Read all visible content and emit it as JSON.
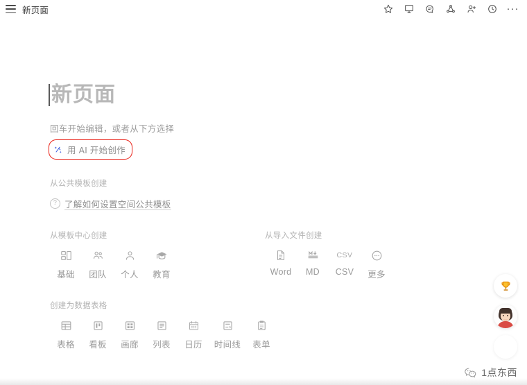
{
  "topbar": {
    "menu_icon": "hamburger-menu-icon",
    "doc_title": "新页面",
    "icons": [
      {
        "name": "star-icon",
        "label": "收藏"
      },
      {
        "name": "presentation-icon",
        "label": "演示"
      },
      {
        "name": "comment-icon",
        "label": "评论"
      },
      {
        "name": "share-network-icon",
        "label": "分享"
      },
      {
        "name": "add-person-icon",
        "label": "协作者"
      },
      {
        "name": "history-clock-icon",
        "label": "历史"
      },
      {
        "name": "more-dots-icon",
        "label": "更多"
      }
    ],
    "more_glyph": "···"
  },
  "document": {
    "title_placeholder": "新页面",
    "hint": "回车开始编辑，或者从下方选择",
    "ai_action": {
      "icon": "ai-sparkle-icon",
      "label": "用 AI 开始创作",
      "highlight_color": "#e8190f"
    }
  },
  "public_template_section": {
    "label": "从公共模板创建",
    "link": {
      "icon": "question-circle-icon",
      "label": "了解如何设置空间公共模板"
    }
  },
  "template_center_section": {
    "label": "从模板中心创建",
    "items": [
      {
        "icon": "layout-grid-icon",
        "label": "基础"
      },
      {
        "icon": "team-people-icon",
        "label": "团队"
      },
      {
        "icon": "person-icon",
        "label": "个人"
      },
      {
        "icon": "graduation-cap-icon",
        "label": "教育"
      }
    ]
  },
  "import_section": {
    "label": "从导入文件创建",
    "items": [
      {
        "icon": "document-icon",
        "label": "Word"
      },
      {
        "icon": "markdown-icon",
        "label": "MD"
      },
      {
        "icon": "csv-text-icon",
        "label": "CSV",
        "glyph_text": "CSV"
      },
      {
        "icon": "more-circle-icon",
        "label": "更多"
      }
    ]
  },
  "database_section": {
    "label": "创建为数据表格",
    "items": [
      {
        "icon": "table-icon",
        "label": "表格"
      },
      {
        "icon": "kanban-icon",
        "label": "看板"
      },
      {
        "icon": "gallery-icon",
        "label": "画廊"
      },
      {
        "icon": "list-icon",
        "label": "列表"
      },
      {
        "icon": "calendar-icon",
        "label": "日历"
      },
      {
        "icon": "timeline-icon",
        "label": "时间线"
      },
      {
        "icon": "form-icon",
        "label": "表单"
      }
    ]
  },
  "floating_widgets": [
    {
      "name": "trophy-button",
      "icon": "trophy-icon"
    },
    {
      "name": "user-avatar-button",
      "icon": "avatar-icon"
    },
    {
      "name": "extra-round-button",
      "icon": "blank-circle-icon"
    }
  ],
  "watermark": {
    "icon": "wechat-icon",
    "text": "1点东西"
  }
}
